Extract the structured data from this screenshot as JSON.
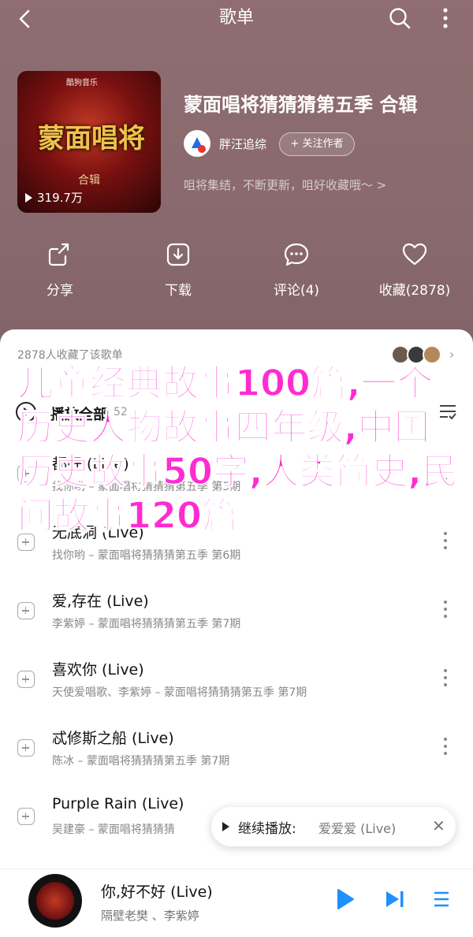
{
  "header": {
    "title": "歌单"
  },
  "album": {
    "brand": "酷狗音乐",
    "art_title": "蒙面唱将",
    "art_collection": "合辑",
    "play_count": "319.7万",
    "title": "蒙面唱将猜猜猜第五季 合辑",
    "creator": "胖汪追综",
    "follow_label": "+ 关注作者",
    "description": "咀将集结，不断更新，咀好收藏哦～ >"
  },
  "actions": [
    {
      "label": "分享",
      "icon": "share-icon"
    },
    {
      "label": "下载",
      "icon": "download-icon"
    },
    {
      "label": "评论(4)",
      "icon": "comment-icon"
    },
    {
      "label": "收藏(2878)",
      "icon": "heart-icon"
    }
  ],
  "list": {
    "collected_text": "2878人收藏了该歌单",
    "play_all_label": "播放全部",
    "play_all_count": "52",
    "songs": [
      {
        "title": "都好 (Live)",
        "subtitle": "找你哟 – 蒙面唱将猜猜猜第五季 第5期"
      },
      {
        "title": "无底洞 (Live)",
        "subtitle": "找你哟 – 蒙面唱将猜猜猜第五季 第6期"
      },
      {
        "title": "爱,存在 (Live)",
        "subtitle": "李紫婷 – 蒙面唱将猜猜猜第五季 第7期"
      },
      {
        "title": "喜欢你 (Live)",
        "subtitle": "天使爱唱歌、李紫婷 – 蒙面唱将猜猜猜第五季 第7期"
      },
      {
        "title": "忒修斯之船 (Live)",
        "subtitle": "陈冰 – 蒙面唱将猜猜猜第五季 第7期"
      },
      {
        "title": "Purple Rain (Live)",
        "subtitle": "吴建豪 – 蒙面唱将猜猜猜"
      }
    ]
  },
  "resume": {
    "label": "继续播放:",
    "song": "爱爱爱 (Live)"
  },
  "player": {
    "title": "你,好不好 (Live)",
    "artist": "隔壁老樊 、李紫婷"
  },
  "overlay_text": "儿童经典故事100篇,一个历史人物故事四年级,中国历史故事50字,人类简史,民间故事120篇",
  "colors": {
    "hero_bg": "#8a6a6e",
    "accent": "#1e90ff",
    "overlay": "#ff2bd2"
  }
}
